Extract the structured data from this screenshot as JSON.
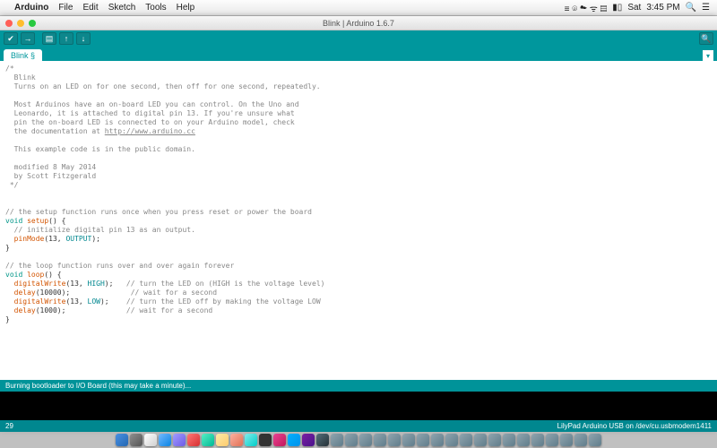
{
  "menubar": {
    "apple": "",
    "app": "Arduino",
    "items": [
      "File",
      "Edit",
      "Sketch",
      "Tools",
      "Help"
    ],
    "status": {
      "icons": "≡ ⌾ ☁ ᯤ ▤",
      "battery": "▮▯",
      "day": "Sat",
      "time": "3:45 PM",
      "search": "🔍",
      "menu": "☰"
    }
  },
  "window": {
    "title": "Blink | Arduino 1.6.7"
  },
  "toolbar": {
    "verify": "✔",
    "upload": "→",
    "new": "▤",
    "open": "↑",
    "save": "↓",
    "serial": "🔍"
  },
  "tab": {
    "name": "Blink §",
    "menu": "▾"
  },
  "code": {
    "c1": "/*",
    "c2": "  Blink",
    "c3": "  Turns on an LED on for one second, then off for one second, repeatedly.",
    "c4": "",
    "c5": "  Most Arduinos have an on-board LED you can control. On the Uno and",
    "c6": "  Leonardo, it is attached to digital pin 13. If you're unsure what",
    "c7": "  pin the on-board LED is connected to on your Arduino model, check",
    "c8a": "  the documentation at ",
    "c8b": "http://www.arduino.cc",
    "c9": "",
    "c10": "  This example code is in the public domain.",
    "c11": "",
    "c12": "  modified 8 May 2014",
    "c13": "  by Scott Fitzgerald",
    "c14": " */",
    "c15": "",
    "c16": "",
    "c17": "// the setup function runs once when you press reset or power the board",
    "kw_void1": "void",
    "fn_setup": " setup",
    "p_setup": "() {",
    "c19": "  // initialize digital pin 13 as an output.",
    "fn_pinmode": "  pinMode",
    "p_pinmode1": "(13, ",
    "cn_output": "OUTPUT",
    "p_pinmode2": ");",
    "c21": "}",
    "c22": "",
    "c23": "// the loop function runs over and over again forever",
    "kw_void2": "void",
    "fn_loop": " loop",
    "p_loop": "() {",
    "fn_dw1": "  digitalWrite",
    "p_dw1a": "(13, ",
    "cn_high": "HIGH",
    "p_dw1b": ");   ",
    "cm_dw1": "// turn the LED on (HIGH is the voltage level)",
    "fn_delay1": "  delay",
    "p_delay1": "(10000);              ",
    "cm_delay1": "// wait for a second",
    "fn_dw2": "  digitalWrite",
    "p_dw2a": "(13, ",
    "cn_low": "LOW",
    "p_dw2b": ");    ",
    "cm_dw2": "// turn the LED off by making the voltage LOW",
    "fn_delay2": "  delay",
    "p_delay2": "(1000);              ",
    "cm_delay2": "// wait for a second",
    "c29": "}"
  },
  "status": {
    "message": "Burning bootloader to I/O Board (this may take a minute)..."
  },
  "footer": {
    "line": "29",
    "board": "LilyPad Arduino USB on /dev/cu.usbmodem1411"
  }
}
